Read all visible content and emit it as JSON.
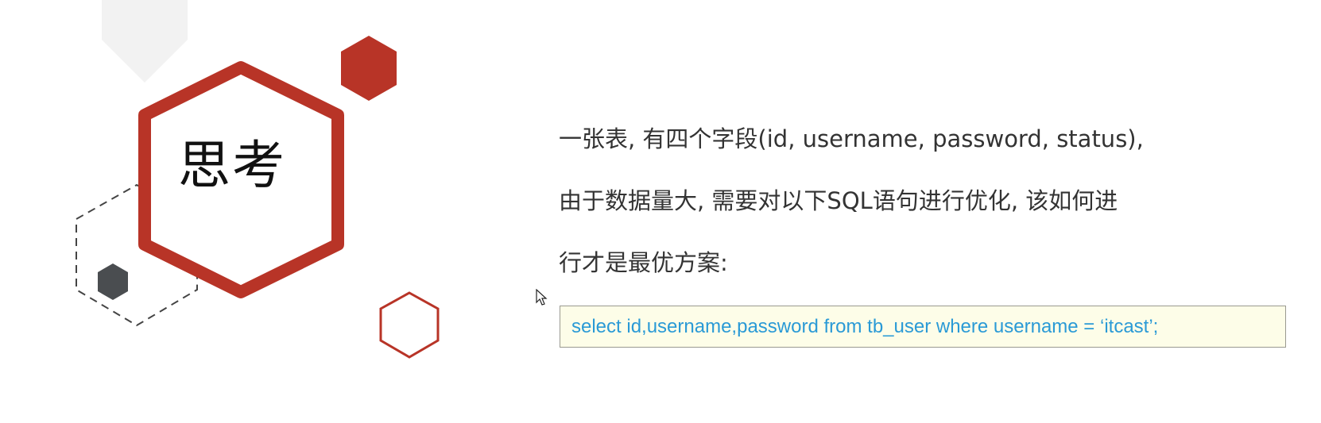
{
  "title": "思考",
  "question": {
    "lines": [
      "一张表, 有四个字段(id, username, password, status),",
      "由于数据量大, 需要对以下SQL语句进行优化, 该如何进",
      "行才是最优方案:"
    ]
  },
  "sql": {
    "statement": "select  id,username,password  from  tb_user  where  username = ‘itcast’;"
  },
  "colors": {
    "accent_red": "#b83427",
    "sql_text": "#2a9ad6",
    "sql_bg": "#fdfde8",
    "dark_hex": "#4a4d50",
    "light_hex": "#f2f2f2"
  },
  "icons": [
    "mouse-cursor-icon"
  ]
}
